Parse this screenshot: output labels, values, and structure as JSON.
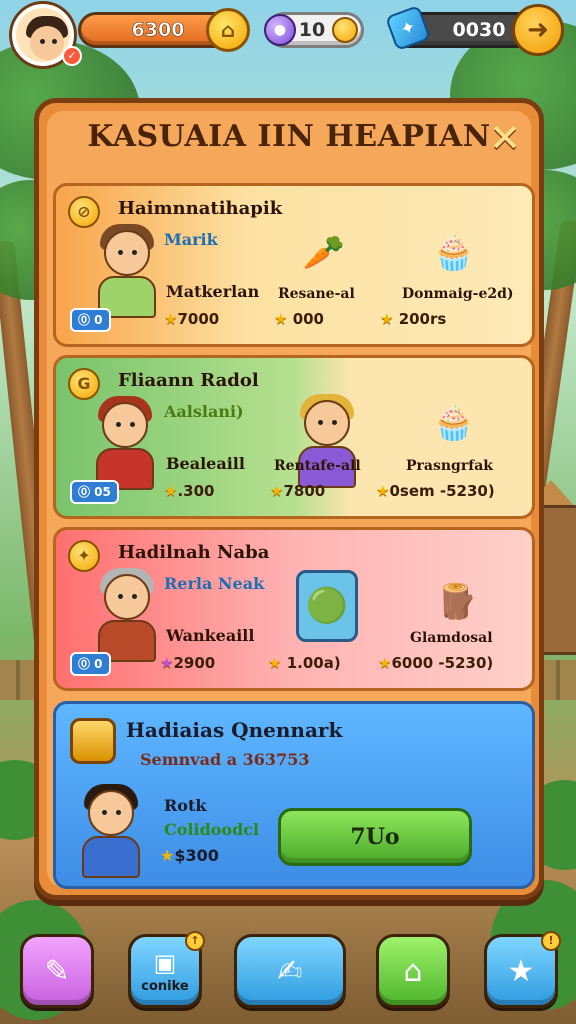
{
  "hud": {
    "coins": "6300",
    "gems": "10",
    "tickets": "0030",
    "avatar_badge": "✓",
    "house_icon": "⌂",
    "arrow_icon": "➜",
    "ticket_icon": "✦"
  },
  "panel": {
    "title": "KASUAIA IIN HEAPIAN",
    "close": "✕"
  },
  "cards": [
    {
      "icon": "⊘",
      "title": "Haimnnatihapik",
      "sub": "Marik",
      "char_label": "Matkerlan",
      "char_price": "7000",
      "badge": "⓪ 0",
      "item1_label": "Resane-al",
      "item1_price": "000",
      "item2_label": "Donmaig-e2d)",
      "item2_price": "200rs"
    },
    {
      "icon": "G",
      "title": "Fliaann Radol",
      "sub": "Aalslani)",
      "char_label": "Bealeaill",
      "char_price": ".300",
      "badge": "⓪ 05",
      "item1_label": "Rentafe-all",
      "item1_price": "7800",
      "item2_label": "Prasngrfak",
      "item2_price": "0sem -5230)"
    },
    {
      "icon": "✦",
      "title": "Hadilnah Naba",
      "sub": "Rerla Neak",
      "char_label": "Wankeaill",
      "char_price": "2900",
      "badge": "⓪ 0",
      "item1_label": "",
      "item1_price": "1.00a)",
      "item2_label": "Glamdosal",
      "item2_price": "6000 -5230)"
    }
  ],
  "featured": {
    "title": "Hadiaias Qnennark",
    "sub": "Semnvad a 363753",
    "name": "Rotk",
    "tag": "Colidoodcl",
    "price": "$300",
    "button": "7Uo"
  },
  "nav": {
    "item2_label": "conike",
    "item2_dot": "↑",
    "item5_dot": "!"
  }
}
